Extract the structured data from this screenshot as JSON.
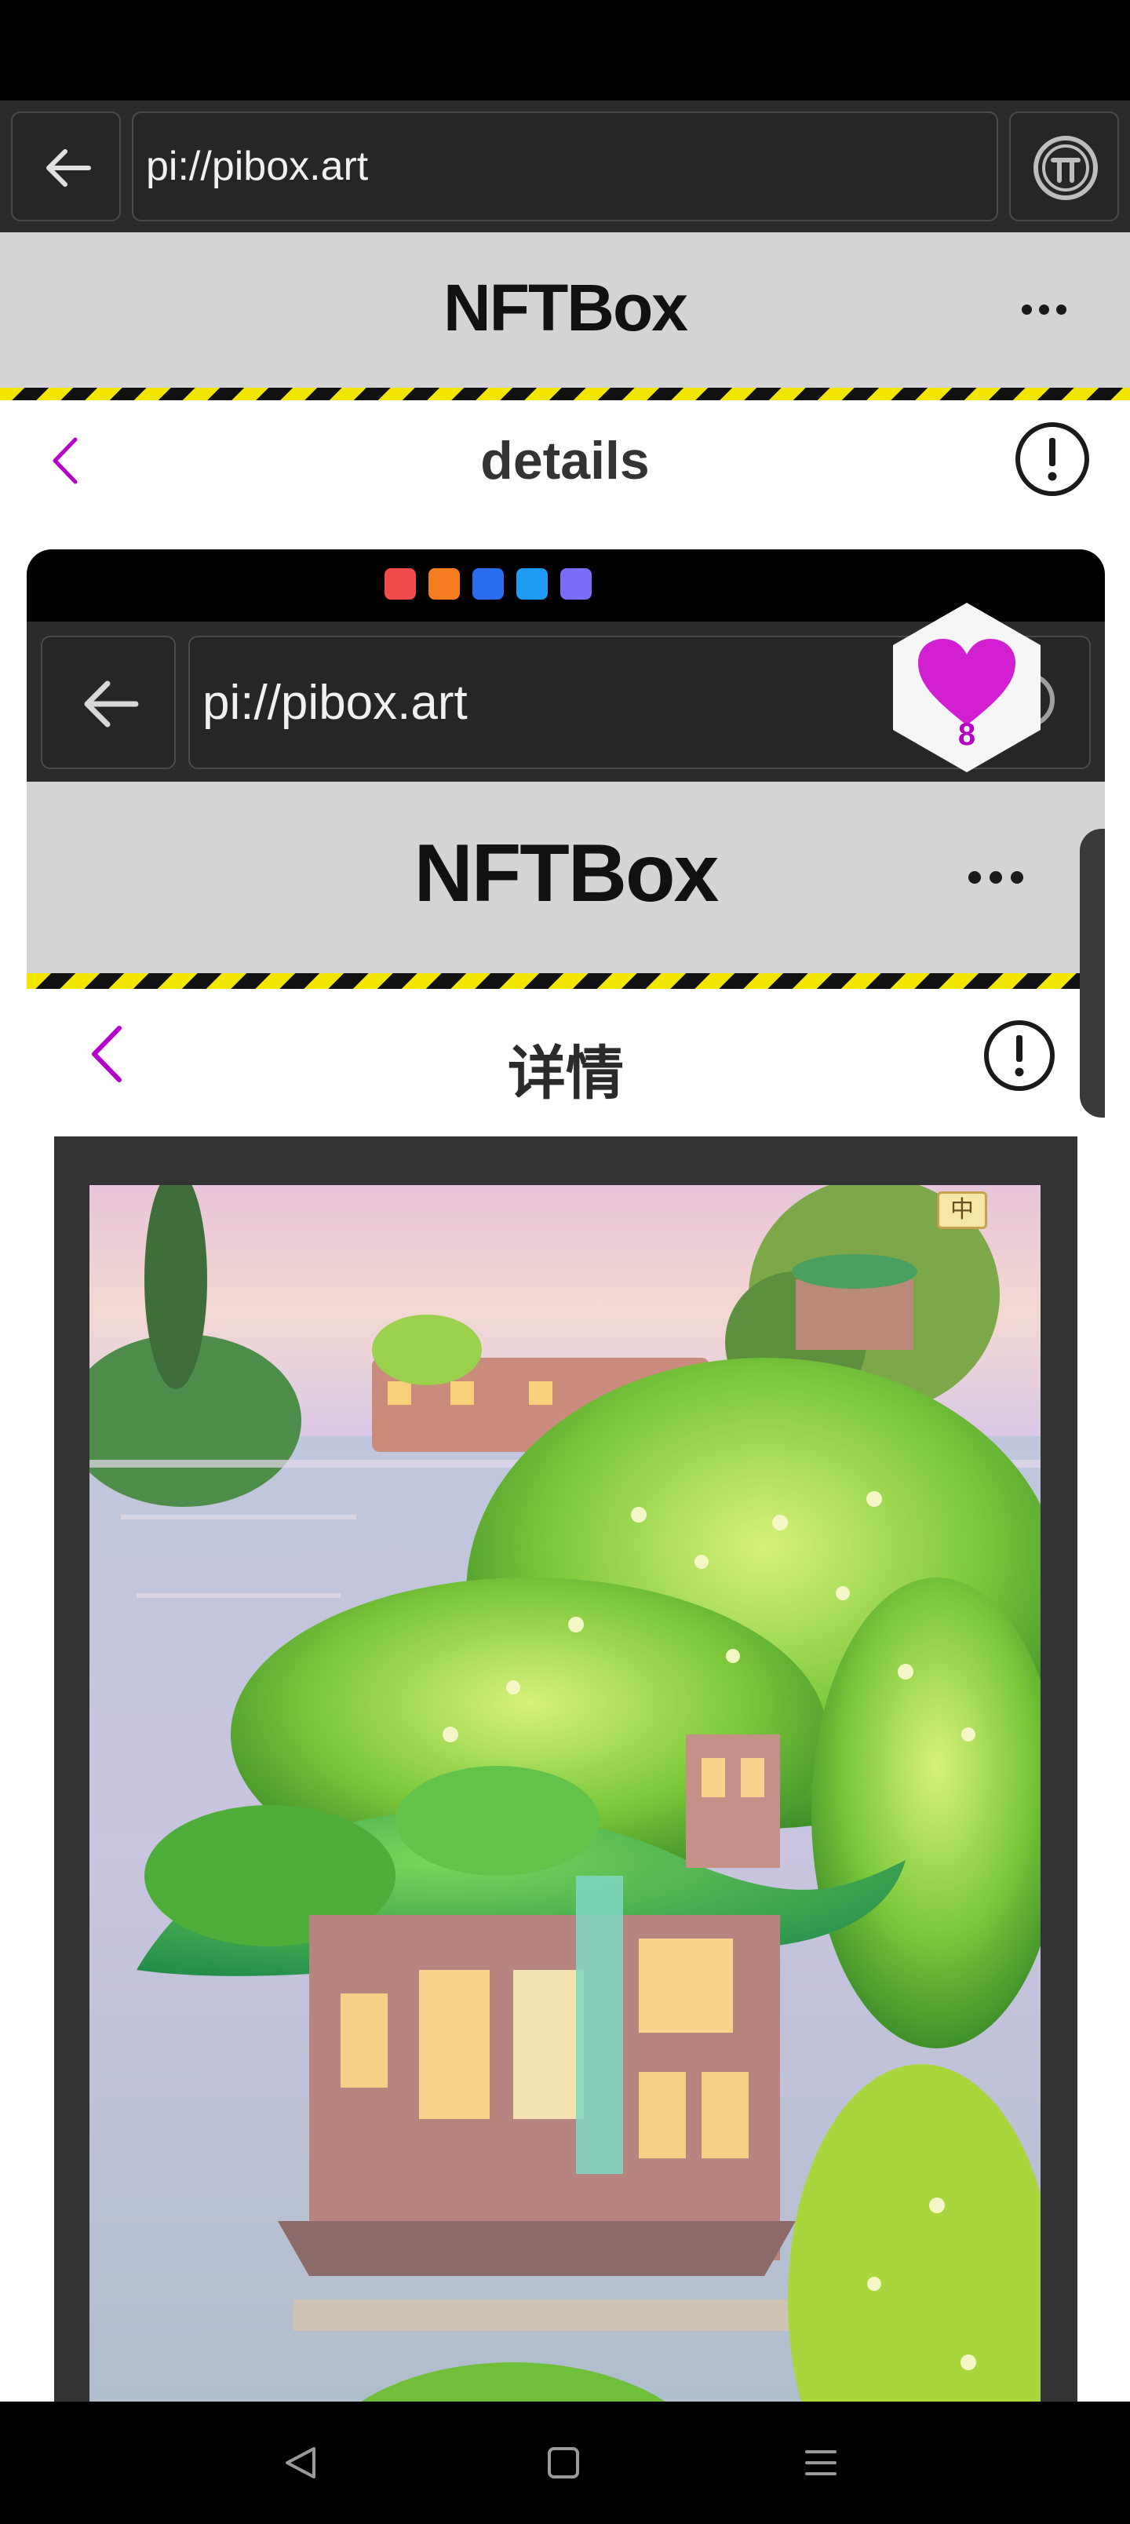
{
  "browser": {
    "url": "pi://pibox.art",
    "back_icon": "arrow-left-icon",
    "menu_icon": "pi-logo-icon"
  },
  "app": {
    "title": "NFTBox",
    "more_icon": "more-dots-icon"
  },
  "details_page": {
    "title": "details",
    "back_icon": "chevron-left-icon",
    "report_icon": "exclamation-circle-icon"
  },
  "embedded_screenshot": {
    "browser_url": "pi://pibox.art",
    "app_title": "NFTBox",
    "page_title": "详情",
    "image_badge": "中",
    "like_count": "8"
  },
  "colors": {
    "accent_purple": "#b400c8",
    "like_magenta": "#d21fd2",
    "hazard_yellow": "#f2e600",
    "header_gray": "#d4d4d4"
  },
  "nav_bar": {
    "back_icon": "triangle-back-icon",
    "home_icon": "square-home-icon",
    "menu_icon": "hamburger-menu-icon"
  }
}
